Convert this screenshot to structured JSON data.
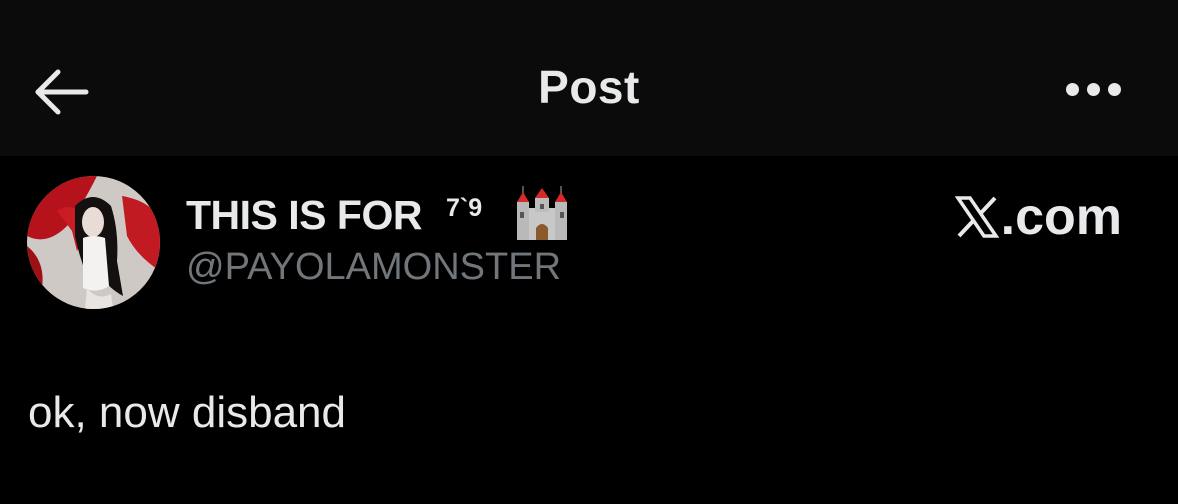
{
  "header": {
    "title": "Post",
    "back_icon": "arrow-left-icon",
    "more_icon": "more-horizontal-icon"
  },
  "author": {
    "display_name": "THIS IS FOR",
    "name_superscript": "7`9",
    "name_emoji": "castle-icon",
    "handle": "@PAYOLAMONSTER"
  },
  "watermark": {
    "text": ".com",
    "logo_icon": "x-logo-icon"
  },
  "post": {
    "text": "ok, now disband"
  },
  "colors": {
    "background": "#000000",
    "header_background": "#0b0b0b",
    "primary_text": "#e7e9ea",
    "secondary_text": "#71767b"
  }
}
